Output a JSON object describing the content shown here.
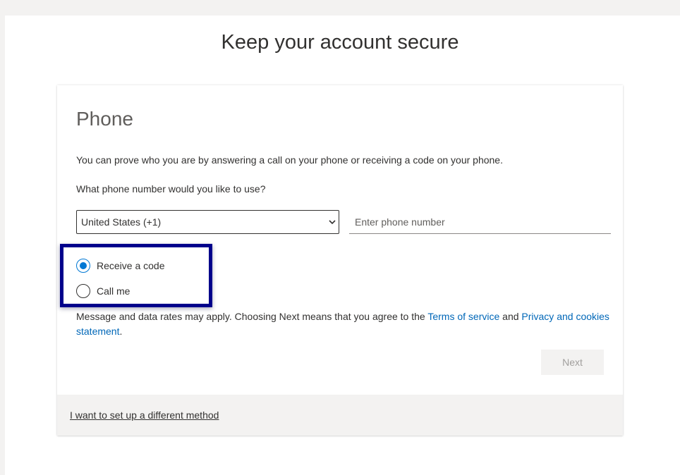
{
  "page": {
    "title": "Keep your account secure"
  },
  "method": {
    "title": "Phone",
    "description": "You can prove who you are by answering a call on your phone or receiving a code on your phone.",
    "question": "What phone number would you like to use?"
  },
  "country_select": {
    "selected": "United States (+1)"
  },
  "phone_input": {
    "value": "",
    "placeholder": "Enter phone number"
  },
  "options": [
    {
      "label": "Receive a code",
      "checked": true
    },
    {
      "label": "Call me",
      "checked": false
    }
  ],
  "disclaimer": {
    "prefix": "Message and data rates may apply. Choosing Next means that you agree to the ",
    "terms_link": "Terms of service",
    "middle": " and ",
    "privacy_link": "Privacy and cookies statement",
    "suffix": "."
  },
  "buttons": {
    "next_label": "Next"
  },
  "footer": {
    "alt_method_link": "I want to set up a different method"
  },
  "colors": {
    "accent": "#0078d4",
    "link": "#0067b8",
    "highlight": "#00008b"
  }
}
